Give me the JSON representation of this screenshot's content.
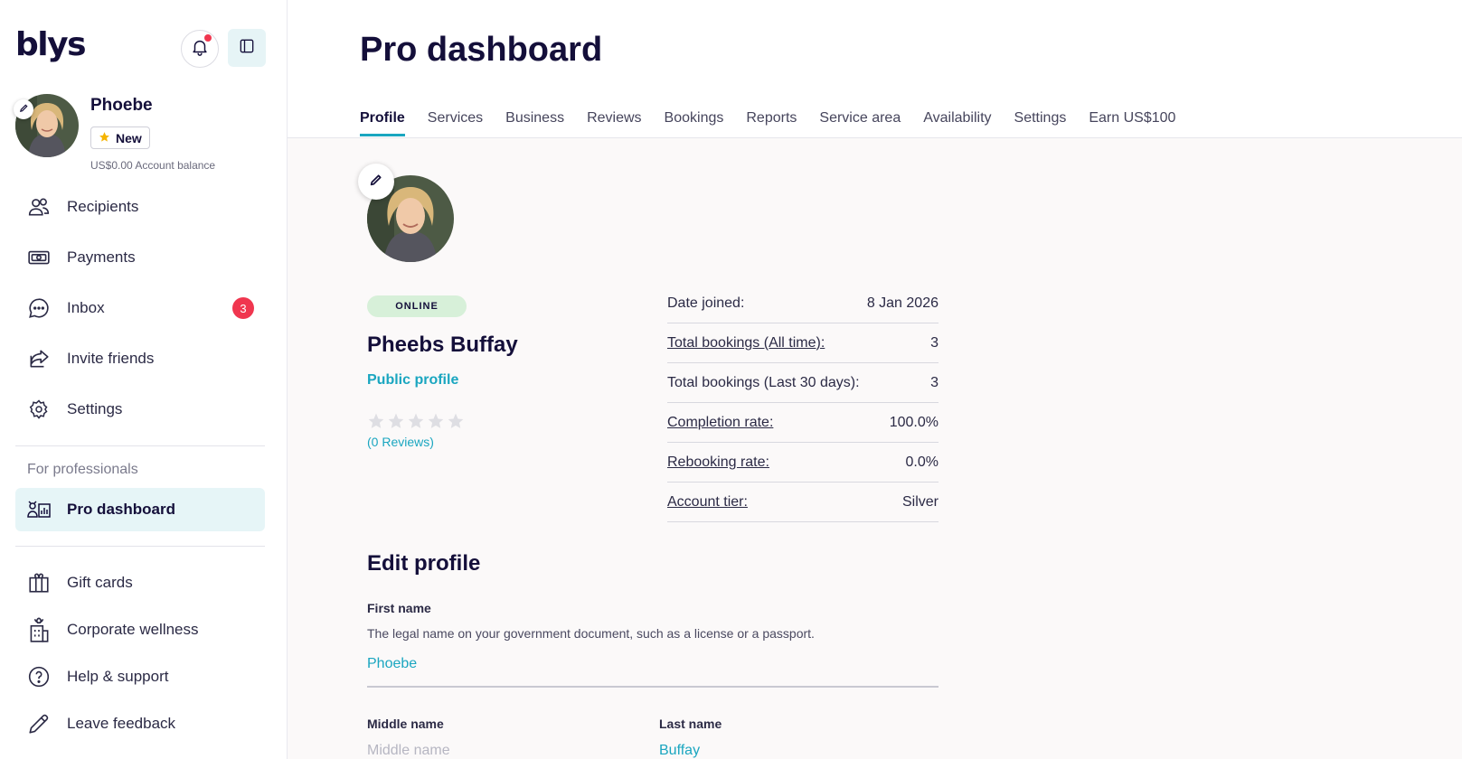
{
  "sidebar": {
    "logo": "blys",
    "user": {
      "name": "Phoebe",
      "badge": "New",
      "balance": "US$0.00 Account balance"
    },
    "nav_top": [
      {
        "label": "Recipients",
        "icon": "people-icon"
      },
      {
        "label": "Payments",
        "icon": "cash-icon"
      },
      {
        "label": "Inbox",
        "icon": "chat-icon",
        "badge": "3"
      },
      {
        "label": "Invite friends",
        "icon": "share-icon"
      },
      {
        "label": "Settings",
        "icon": "gear-icon"
      }
    ],
    "section_label": "For professionals",
    "pro_item": {
      "label": "Pro dashboard",
      "icon": "pro-dashboard-icon"
    },
    "nav_bottom": [
      {
        "label": "Gift cards",
        "icon": "gift-icon"
      },
      {
        "label": "Corporate wellness",
        "icon": "building-icon"
      },
      {
        "label": "Help & support",
        "icon": "help-icon"
      },
      {
        "label": "Leave feedback",
        "icon": "pencil-icon"
      }
    ]
  },
  "main": {
    "title": "Pro dashboard",
    "tabs": [
      "Profile",
      "Services",
      "Business",
      "Reviews",
      "Bookings",
      "Reports",
      "Service area",
      "Availability",
      "Settings",
      "Earn US$100"
    ],
    "active_tab": "Profile",
    "profile": {
      "status": "ONLINE",
      "name": "Pheebs Buffay",
      "public_link": "Public profile",
      "reviews": "(0 Reviews)",
      "rating_stars": 0
    },
    "stats": [
      {
        "label": "Date joined:",
        "value": "8 Jan 2026",
        "link": false
      },
      {
        "label": "Total bookings (All time):",
        "value": "3",
        "link": true
      },
      {
        "label": "Total bookings (Last 30 days):",
        "value": "3",
        "link": false
      },
      {
        "label": "Completion rate:",
        "value": "100.0%",
        "link": true
      },
      {
        "label": "Rebooking rate:",
        "value": "0.0%",
        "link": true
      },
      {
        "label": "Account tier:",
        "value": "Silver",
        "link": true
      }
    ],
    "edit_profile": {
      "title": "Edit profile",
      "first_name_label": "First name",
      "first_name_help": "The legal name on your government document, such as a license or a passport.",
      "first_name_value": "Phoebe",
      "middle_name_label": "Middle name",
      "middle_name_placeholder": "Middle name",
      "last_name_label": "Last name",
      "last_name_value": "Buffay"
    }
  },
  "colors": {
    "brand_dark": "#140f3a",
    "accent_teal": "#1aa6c0",
    "badge_red": "#f0364f",
    "online_green_bg": "#d7f0d9",
    "active_nav_bg": "#e6f5f7"
  }
}
